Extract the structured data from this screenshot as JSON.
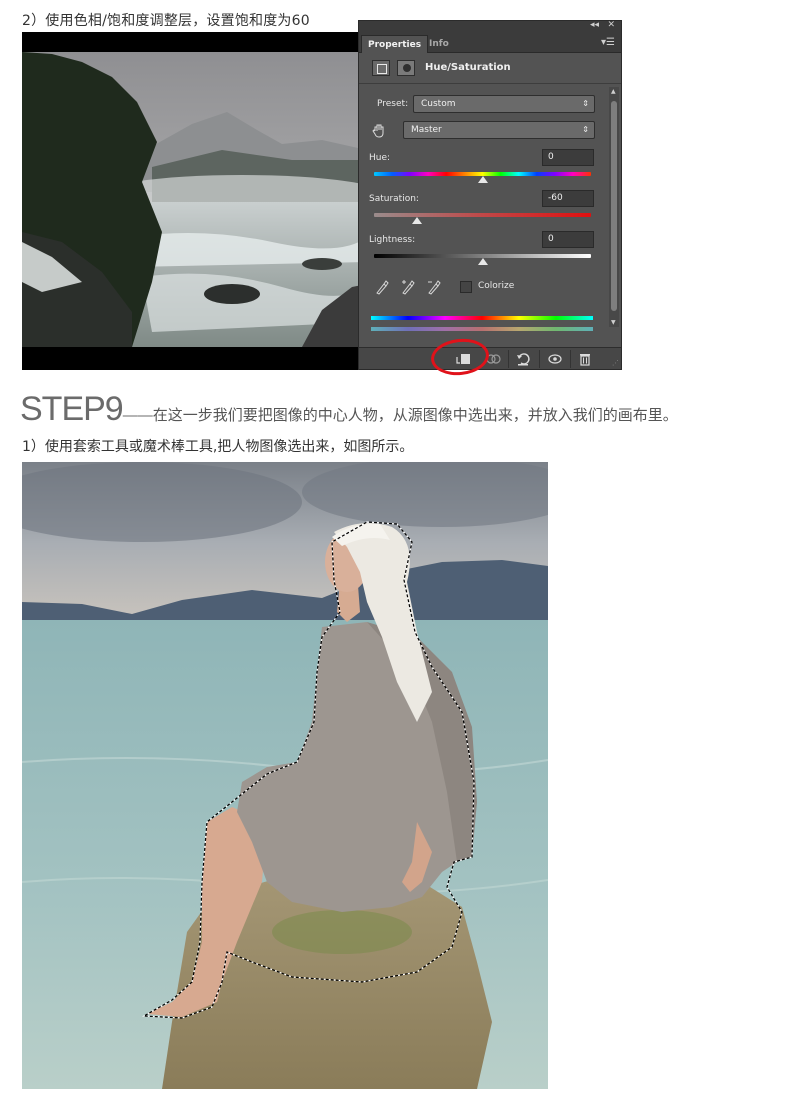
{
  "captions": {
    "step8_sub": "2）使用色相/饱和度调整层，设置饱和度为60",
    "step9_title": "STEP9",
    "step9_dash": "——",
    "step9_desc": "在这一步我们要把图像的中心人物，从源图像中选出来，并放入我们的画布里。",
    "step9_sub": "1）使用套索工具或魔术棒工具,把人物图像选出来，如图所示。"
  },
  "panel": {
    "tabs": [
      "Properties",
      "Info"
    ],
    "collapse_glyph": "◂◂",
    "close_glyph": "✕",
    "menu_glyph": "▾☰",
    "title": "Hue/Saturation",
    "preset_label": "Preset:",
    "preset_value": "Custom",
    "channel_value": "Master",
    "hue_label": "Hue:",
    "hue_value": "0",
    "saturation_label": "Saturation:",
    "saturation_value": "-60",
    "lightness_label": "Lightness:",
    "lightness_value": "0",
    "colorize_label": "Colorize",
    "select_arrow": "⇕",
    "slider_levels": {
      "hue": 0.5,
      "saturation": 0.2,
      "lightness": 0.5
    },
    "icons": {
      "hand": "on-image-adjust-icon",
      "eyedroppers": [
        "eyedropper-icon",
        "eyedropper-plus-icon",
        "eyedropper-minus-icon"
      ],
      "bottom": [
        "clip-to-layer-icon",
        "view-previous-icon",
        "reset-icon",
        "visibility-icon",
        "delete-icon"
      ]
    }
  },
  "colors": {
    "highlight": "#e0121a",
    "panel_bg": "#535353",
    "step_heading": "#6b6b6b"
  }
}
